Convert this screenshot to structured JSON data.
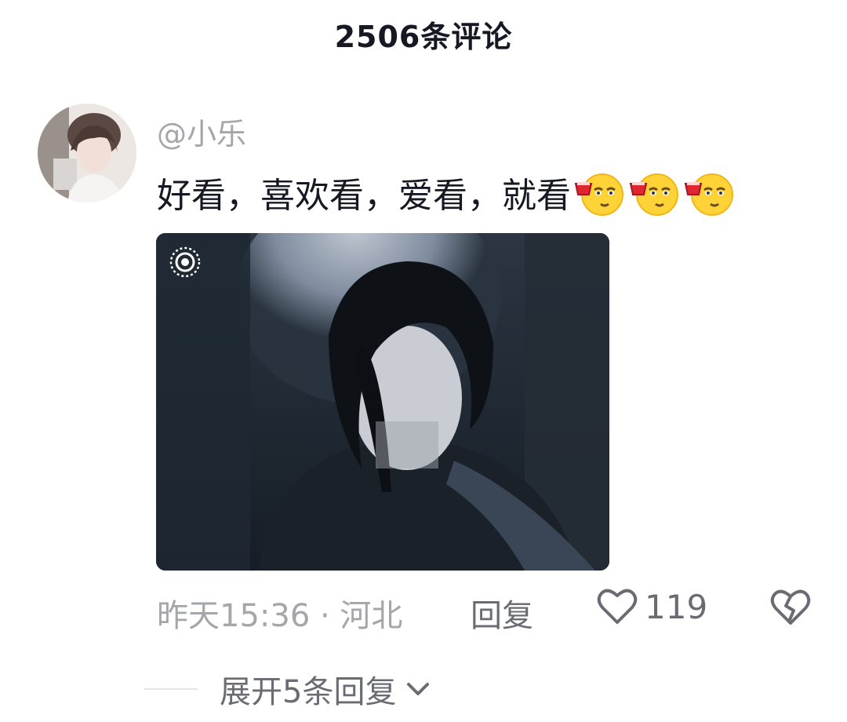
{
  "header": {
    "title": "2506条评论"
  },
  "comment": {
    "username": "@小乐",
    "text": "好看，喜欢看，爱看，就看",
    "emojis": [
      "toast-emoji",
      "toast-emoji",
      "toast-emoji"
    ],
    "time_location": "昨天15:36 · 河北",
    "reply_label": "回复",
    "like_count": "119",
    "expand_replies_label": "展开5条回复"
  },
  "icons": {
    "like": "heart-outline-icon",
    "dislike": "broken-heart-icon",
    "expand": "chevron-down-icon",
    "live": "live-photo-icon"
  }
}
